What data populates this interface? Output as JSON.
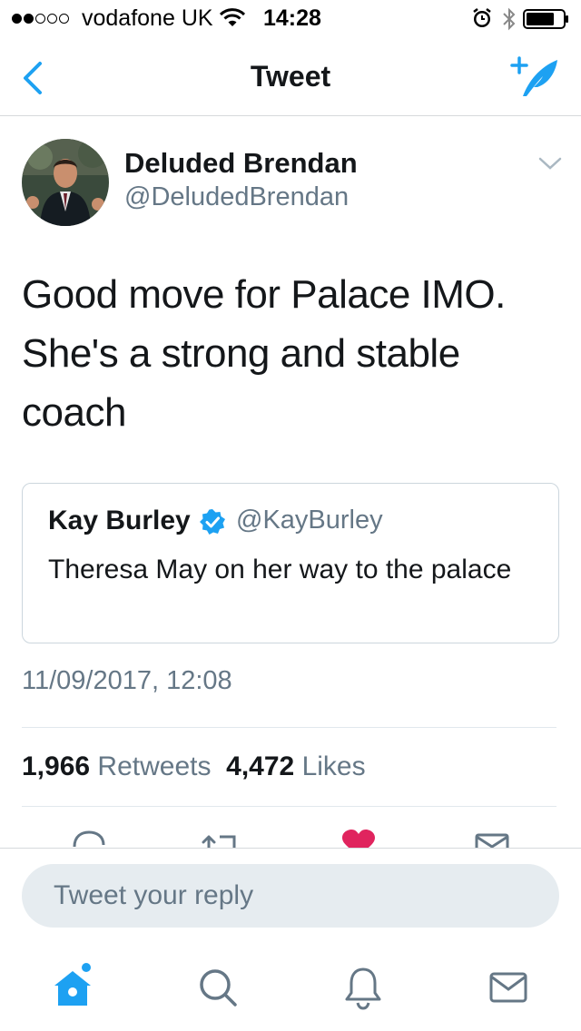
{
  "status_bar": {
    "carrier": "vodafone UK",
    "time": "14:28"
  },
  "nav": {
    "title": "Tweet"
  },
  "tweet": {
    "display_name": "Deluded Brendan",
    "handle": "@DeludedBrendan",
    "text": "Good move for Palace IMO. She's a strong and stable coach",
    "quoted": {
      "display_name": "Kay Burley",
      "handle": "@KayBurley",
      "text": "Theresa May on her way to the palace"
    },
    "timestamp": "11/09/2017, 12:08",
    "retweets_count": "1,966",
    "retweets_label": "Retweets",
    "likes_count": "4,472",
    "likes_label": "Likes"
  },
  "reply": {
    "placeholder": "Tweet your reply"
  },
  "icons": {
    "back": "chevron-left-icon",
    "compose": "compose-tweet-icon",
    "caret": "chevron-down-icon",
    "verified": "verified-badge-icon",
    "reply": "reply-icon",
    "retweet": "retweet-icon",
    "like": "heart-icon",
    "dm": "envelope-icon",
    "home": "home-icon",
    "search": "search-icon",
    "notifications": "bell-icon",
    "messages": "envelope-icon"
  },
  "colors": {
    "accent": "#1da1f2",
    "like": "#e0245e",
    "secondary_text": "#657786",
    "divider": "#e1e8ed"
  }
}
